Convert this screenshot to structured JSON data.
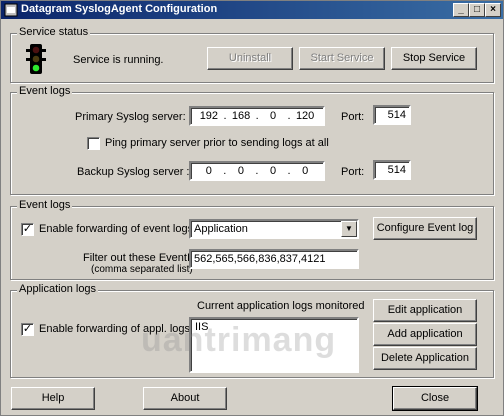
{
  "window": {
    "title": "Datagram SyslogAgent Configuration",
    "controls": [
      "_",
      "□",
      "×"
    ]
  },
  "service_status": {
    "legend": "Service status",
    "status_text": "Service is running.",
    "buttons": {
      "uninstall": "Uninstall",
      "start": "Start Service",
      "stop": "Stop Service"
    }
  },
  "event_logs_server": {
    "legend": "Event logs",
    "primary_label": "Primary Syslog server:",
    "primary_ip": [
      "192",
      "168",
      "0",
      "120"
    ],
    "primary_port_label": "Port:",
    "primary_port": "514",
    "ping_label": "Ping primary server prior to sending logs at all",
    "ping_checked": false,
    "backup_label": "Backup Syslog server :",
    "backup_ip": [
      "0",
      "0",
      "0",
      "0"
    ],
    "backup_port_label": "Port:",
    "backup_port": "514"
  },
  "event_logs_forward": {
    "legend": "Event logs",
    "enable_label": "Enable forwarding of event logs",
    "enable_checked": true,
    "selected_log": "Application",
    "configure_button": "Configure Event log",
    "filter_label": "Filter out these EventIDs:",
    "filter_sublabel": "(comma separated list)",
    "filter_value": "562,565,566,836,837,4121"
  },
  "application_logs": {
    "legend": "Application logs",
    "monitored_label": "Current application logs monitored",
    "enable_label": "Enable forwarding of appl. logs",
    "enable_checked": true,
    "monitored_items": [
      "IIS"
    ],
    "buttons": {
      "edit": "Edit application",
      "add": "Add application",
      "delete": "Delete Application"
    }
  },
  "footer": {
    "help": "Help",
    "about": "About",
    "close": "Close"
  },
  "watermark": "uantrimang",
  "colors": {
    "titlebar_start": "#0a246a",
    "titlebar_end": "#3a6ea5",
    "face": "#d4d0c8"
  }
}
